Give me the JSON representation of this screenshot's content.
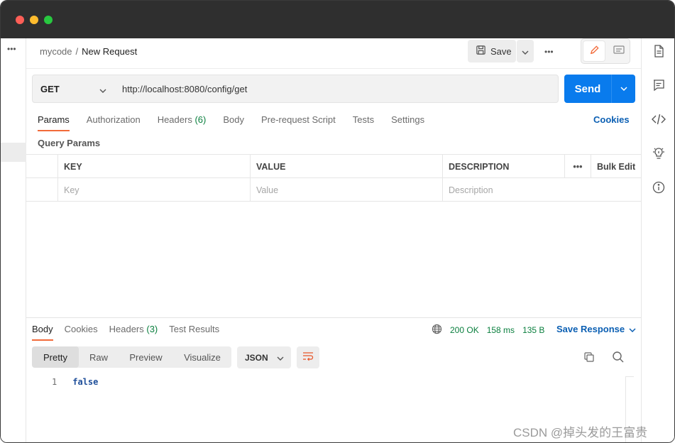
{
  "breadcrumb": {
    "workspace": "mycode",
    "separator": "/",
    "request_name": "New Request"
  },
  "toolbar": {
    "save_label": "Save"
  },
  "request": {
    "method": "GET",
    "url": "http://localhost:8080/config/get",
    "send_label": "Send"
  },
  "request_tabs": [
    {
      "label": "Params"
    },
    {
      "label": "Authorization"
    },
    {
      "label": "Headers",
      "count": "(6)"
    },
    {
      "label": "Body"
    },
    {
      "label": "Pre-request Script"
    },
    {
      "label": "Tests"
    },
    {
      "label": "Settings"
    }
  ],
  "cookies_label": "Cookies",
  "query_params": {
    "title": "Query Params",
    "columns": [
      "KEY",
      "VALUE",
      "DESCRIPTION"
    ],
    "bulk_edit": "Bulk Edit",
    "placeholders": {
      "key": "Key",
      "value": "Value",
      "description": "Description"
    }
  },
  "response": {
    "tabs": [
      {
        "label": "Body"
      },
      {
        "label": "Cookies"
      },
      {
        "label": "Headers",
        "count": "(3)"
      },
      {
        "label": "Test Results"
      }
    ],
    "status": "200 OK",
    "time": "158 ms",
    "size": "135 B",
    "save_response": "Save Response",
    "view_modes": [
      "Pretty",
      "Raw",
      "Preview",
      "Visualize"
    ],
    "format": "JSON",
    "lines": [
      {
        "num": "1",
        "text": "false"
      }
    ]
  },
  "watermark": "CSDN @掉头发的王富贵"
}
